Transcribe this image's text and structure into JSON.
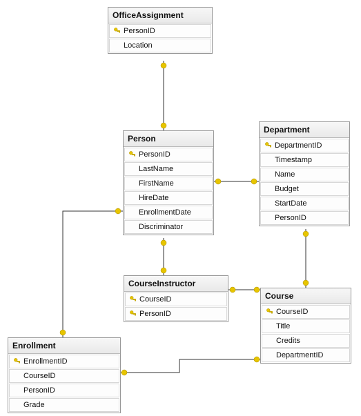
{
  "tables": {
    "officeAssignment": {
      "title": "OfficeAssignment",
      "columns": [
        {
          "name": "PersonID",
          "pk": true
        },
        {
          "name": "Location",
          "pk": false
        }
      ]
    },
    "person": {
      "title": "Person",
      "columns": [
        {
          "name": "PersonID",
          "pk": true
        },
        {
          "name": "LastName",
          "pk": false
        },
        {
          "name": "FirstName",
          "pk": false
        },
        {
          "name": "HireDate",
          "pk": false
        },
        {
          "name": "EnrollmentDate",
          "pk": false
        },
        {
          "name": "Discriminator",
          "pk": false
        }
      ]
    },
    "department": {
      "title": "Department",
      "columns": [
        {
          "name": "DepartmentID",
          "pk": true
        },
        {
          "name": "Timestamp",
          "pk": false
        },
        {
          "name": "Name",
          "pk": false
        },
        {
          "name": "Budget",
          "pk": false
        },
        {
          "name": "StartDate",
          "pk": false
        },
        {
          "name": "PersonID",
          "pk": false
        }
      ]
    },
    "courseInstructor": {
      "title": "CourseInstructor",
      "columns": [
        {
          "name": "CourseID",
          "pk": true
        },
        {
          "name": "PersonID",
          "pk": true
        }
      ]
    },
    "course": {
      "title": "Course",
      "columns": [
        {
          "name": "CourseID",
          "pk": true
        },
        {
          "name": "Title",
          "pk": false
        },
        {
          "name": "Credits",
          "pk": false
        },
        {
          "name": "DepartmentID",
          "pk": false
        }
      ]
    },
    "enrollment": {
      "title": "Enrollment",
      "columns": [
        {
          "name": "EnrollmentID",
          "pk": true
        },
        {
          "name": "CourseID",
          "pk": false
        },
        {
          "name": "PersonID",
          "pk": false
        },
        {
          "name": "Grade",
          "pk": false
        }
      ]
    }
  },
  "relationships": [
    {
      "from": "OfficeAssignment.PersonID",
      "to": "Person.PersonID",
      "type": "one-to-one"
    },
    {
      "from": "Person.PersonID",
      "to": "Department.PersonID",
      "type": "one-to-many"
    },
    {
      "from": "Person.PersonID",
      "to": "CourseInstructor.PersonID",
      "type": "one-to-many"
    },
    {
      "from": "Person.PersonID",
      "to": "Enrollment.PersonID",
      "type": "one-to-many"
    },
    {
      "from": "Course.CourseID",
      "to": "CourseInstructor.CourseID",
      "type": "one-to-many"
    },
    {
      "from": "Course.CourseID",
      "to": "Enrollment.CourseID",
      "type": "one-to-many"
    },
    {
      "from": "Department.DepartmentID",
      "to": "Course.DepartmentID",
      "type": "one-to-many"
    }
  ]
}
